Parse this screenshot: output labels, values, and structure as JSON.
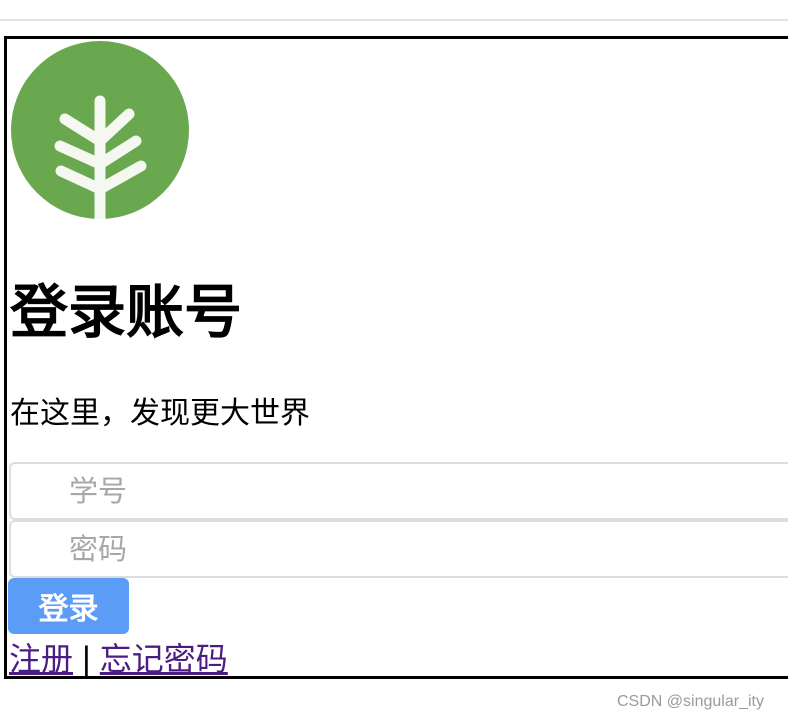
{
  "login": {
    "title": "登录账号",
    "subtitle": "在这里，发现更大世界",
    "student_id_placeholder": "学号",
    "password_placeholder": "密码",
    "login_button": "登录",
    "register_link": "注册",
    "separator": "|",
    "forgot_link": "忘记密码"
  },
  "logo": {
    "icon": "tree-branch-icon",
    "circle_color": "#6aa84f",
    "branch_color": "#ffffff"
  },
  "colors": {
    "button": "#5b9cf7",
    "link": "#4b1d83",
    "frame_border": "#000000"
  },
  "watermark": "CSDN @singular_ity"
}
